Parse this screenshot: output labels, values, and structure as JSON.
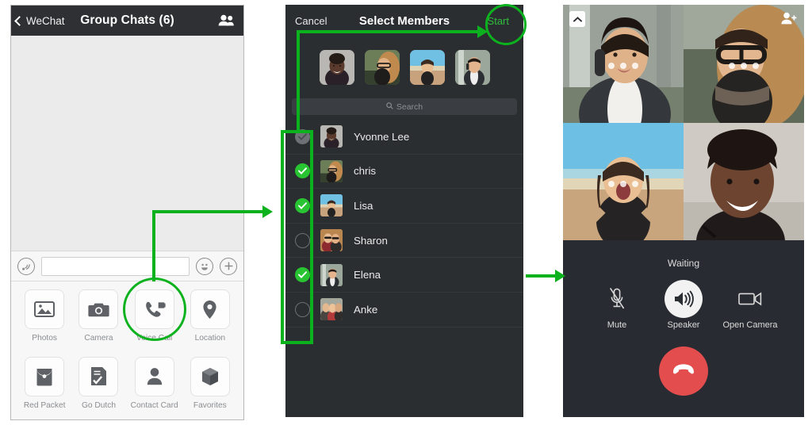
{
  "panel1": {
    "header": {
      "back_label": "WeChat",
      "back_icon": "chevron-left-icon",
      "title": "Group Chats (6)",
      "people_icon": "group-members-icon"
    },
    "input_bar": {
      "voice_icon": "voice-input-icon",
      "text_value": "",
      "text_placeholder": "",
      "emoji_icon": "emoji-smiley-icon",
      "plus_icon": "plus-icon"
    },
    "attachment_grid": [
      {
        "label": "Photos",
        "icon": "photos-icon"
      },
      {
        "label": "Camera",
        "icon": "camera-icon"
      },
      {
        "label": "Voice Call",
        "icon": "voice-call-icon"
      },
      {
        "label": "Location",
        "icon": "location-pin-icon"
      },
      {
        "label": "Red Packet",
        "icon": "red-packet-icon"
      },
      {
        "label": "Go Dutch",
        "icon": "go-dutch-icon"
      },
      {
        "label": "Contact Card",
        "icon": "contact-card-icon"
      },
      {
        "label": "Favorites",
        "icon": "favorites-box-icon"
      }
    ]
  },
  "panel2": {
    "header": {
      "cancel_label": "Cancel",
      "title": "Select Members",
      "start_label": "Start"
    },
    "selected_avatars": [
      {
        "name": "Yvonne Lee"
      },
      {
        "name": "chris"
      },
      {
        "name": "Lisa"
      },
      {
        "name": "Elena"
      }
    ],
    "search": {
      "placeholder": "Search",
      "icon": "search-icon",
      "value": ""
    },
    "contacts": [
      {
        "name": "Yvonne Lee",
        "state": "dim"
      },
      {
        "name": "chris",
        "state": "on"
      },
      {
        "name": "Lisa",
        "state": "on"
      },
      {
        "name": "Sharon",
        "state": "off"
      },
      {
        "name": "Elena",
        "state": "on"
      },
      {
        "name": "Anke",
        "state": "off"
      }
    ]
  },
  "panel3": {
    "collapse_icon": "chevron-up-icon",
    "add_user_icon": "add-user-icon",
    "participants": [
      {
        "position": "top-left",
        "muted_dots": 3
      },
      {
        "position": "top-right",
        "muted_dots": 3
      },
      {
        "position": "bottom-left",
        "muted_dots": 3
      },
      {
        "position": "bottom-right",
        "muted_dots": 0
      }
    ],
    "status": "Waiting",
    "controls": [
      {
        "label": "Mute",
        "icon": "mic-muted-icon",
        "active": false
      },
      {
        "label": "Speaker",
        "icon": "speaker-icon",
        "active": true
      },
      {
        "label": "Open Camera",
        "icon": "video-cam-icon",
        "active": false
      }
    ],
    "hangup": {
      "label": "",
      "icon": "hangup-phone-icon",
      "color": "#e34d4d"
    }
  },
  "annotations": {
    "accent_color": "#0cb21d",
    "highlights": [
      {
        "target": "voice-call-tile",
        "shape": "circle"
      },
      {
        "target": "start-button",
        "shape": "circle"
      },
      {
        "target": "checkbox-column",
        "shape": "rectangle"
      }
    ],
    "flow": [
      {
        "from": "voice-call-tile",
        "to": "checkbox-column"
      },
      {
        "from": "checkbox-column",
        "to": "start-button"
      },
      {
        "from": "select-members",
        "to": "call-screen"
      }
    ]
  }
}
